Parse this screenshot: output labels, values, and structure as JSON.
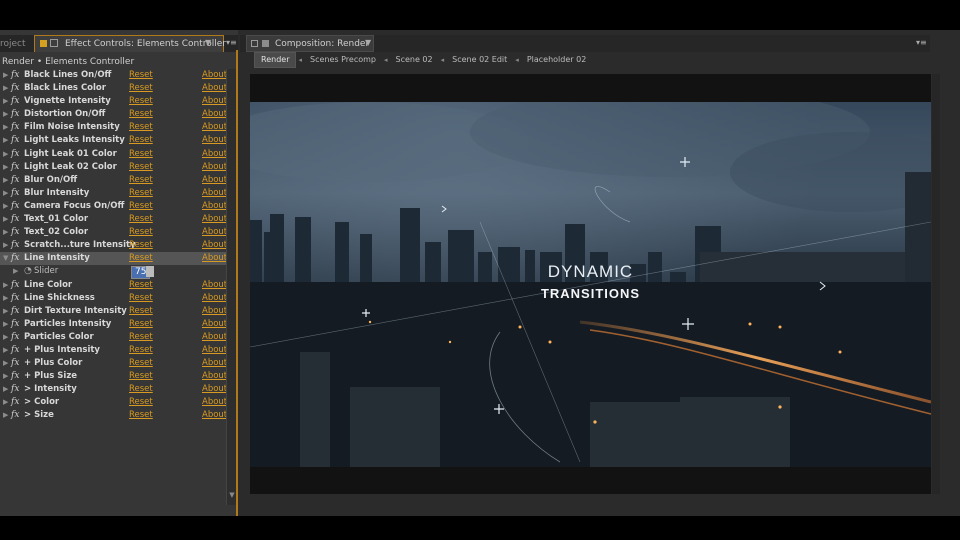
{
  "left_panel": {
    "project_tab": "roject",
    "effect_controls_tab": "Effect Controls: Elements Controller",
    "breadcrumb": "Render • Elements Controller",
    "reset_label": "Reset",
    "about_label": "About",
    "effects": [
      {
        "name": "Black Lines On/Off"
      },
      {
        "name": "Black Lines Color"
      },
      {
        "name": "Vignette Intensity"
      },
      {
        "name": "Distortion On/Off"
      },
      {
        "name": "Film Noise Intensity"
      },
      {
        "name": "Light Leaks Intensity"
      },
      {
        "name": "Light Leak 01 Color"
      },
      {
        "name": "Light Leak 02 Color"
      },
      {
        "name": "Blur On/Off"
      },
      {
        "name": "Blur Intensity"
      },
      {
        "name": "Camera Focus On/Off"
      },
      {
        "name": "Text_01 Color"
      },
      {
        "name": "Text_02 Color"
      },
      {
        "name": "Scratch...ture Intensity"
      },
      {
        "name": "Line Intensity"
      },
      {
        "name": "Line Color"
      },
      {
        "name": "Line Shickness"
      },
      {
        "name": "Dirt Texture Intensity"
      },
      {
        "name": "Particles Intensity"
      },
      {
        "name": "Particles Color"
      },
      {
        "name": "+ Plus Intensity"
      },
      {
        "name": "+ Plus Color"
      },
      {
        "name": "+ Plus Size"
      },
      {
        "name": "> Intensity"
      },
      {
        "name": "> Color"
      },
      {
        "name": "> Size"
      }
    ],
    "slider": {
      "label": "Slider",
      "value": "75"
    }
  },
  "composition": {
    "tab": "Composition: Render",
    "breadcrumbs": [
      "Render",
      "Scenes Precomp",
      "Scene 02",
      "Scene 02 Edit",
      "Placeholder 02"
    ]
  },
  "preview": {
    "title_line1": "DYNAMIC",
    "title_line2": "TRANSITIONS"
  }
}
